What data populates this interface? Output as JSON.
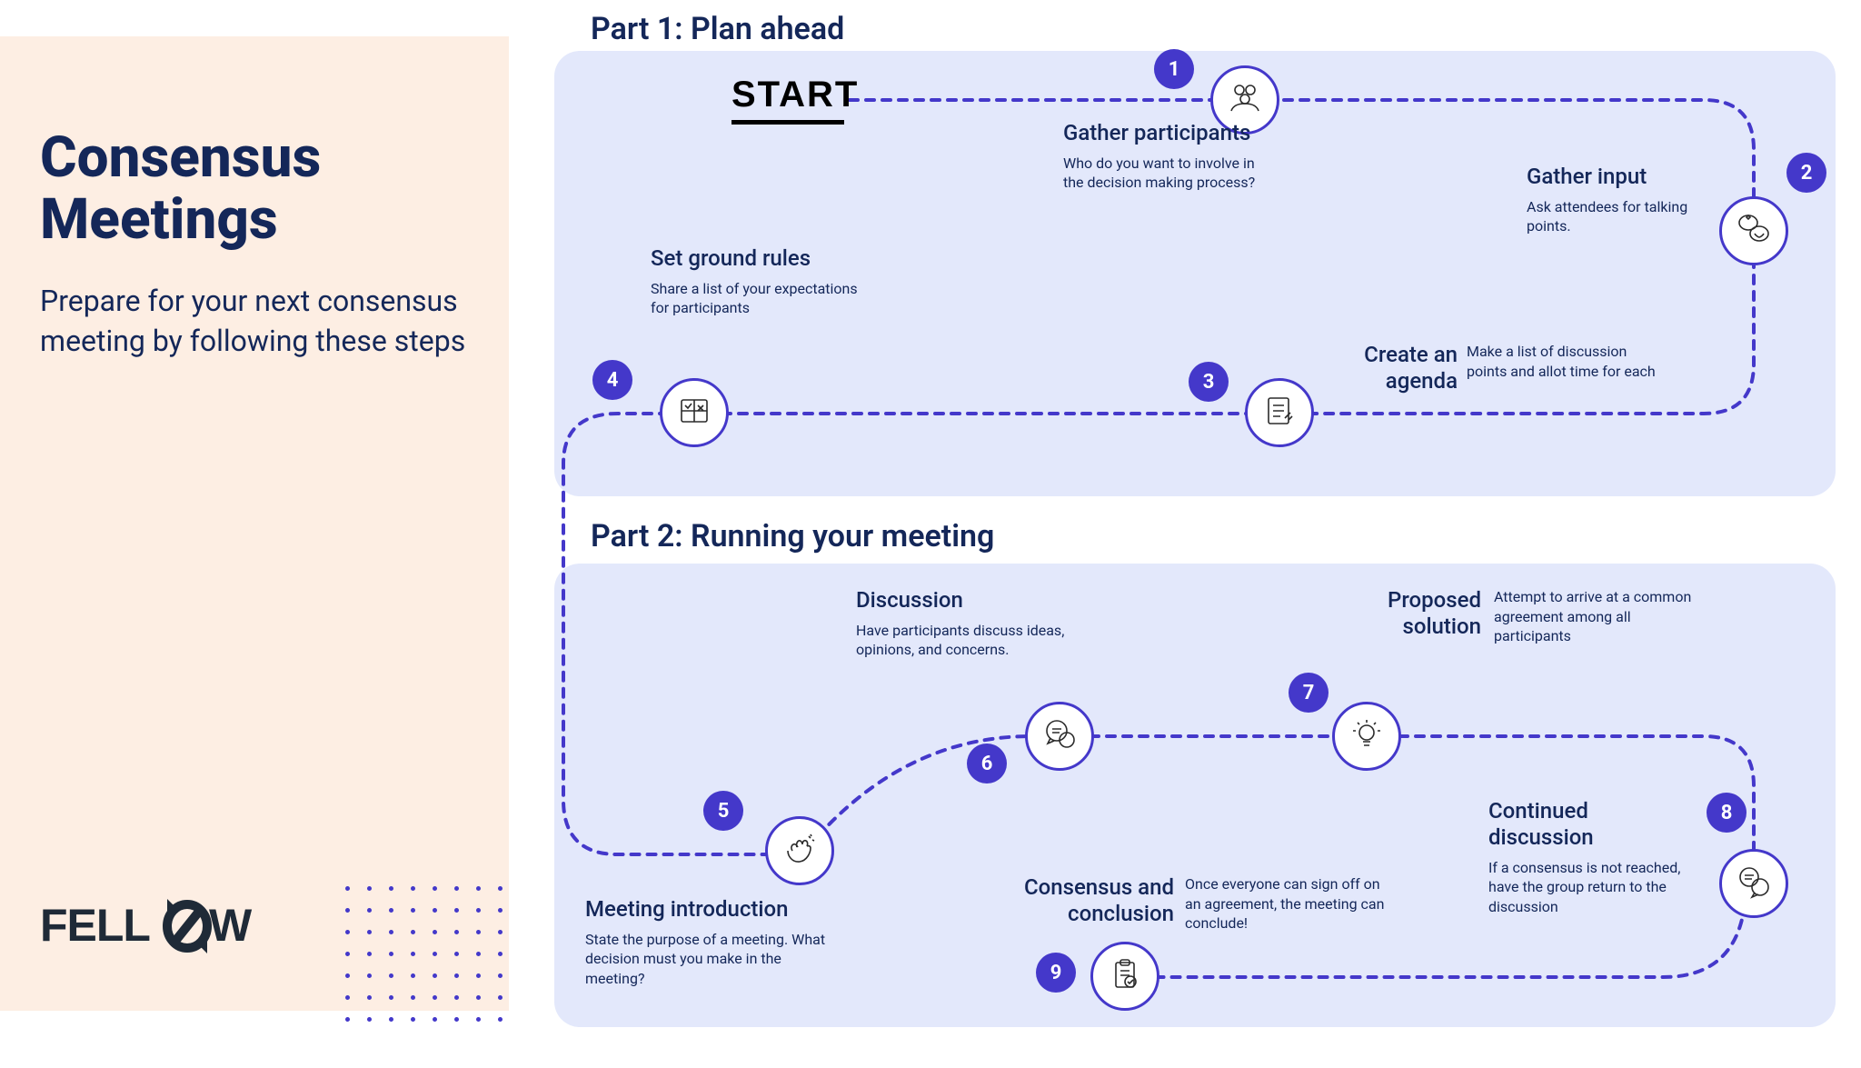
{
  "main_title": "Consensus Meetings",
  "subtitle": "Prepare for your next consensus meeting by following these steps",
  "logo_text": "FELLOW",
  "start_label": "START",
  "part1_title": "Part 1: Plan ahead",
  "part2_title": "Part 2: Running your meeting",
  "steps": {
    "s1": {
      "num": "1",
      "title": "Gather participants",
      "desc": "Who do you want to involve in the decision making process?"
    },
    "s2": {
      "num": "2",
      "title": "Gather input",
      "desc": "Ask attendees for talking points."
    },
    "s3": {
      "num": "3",
      "title": "Create an agenda",
      "desc": "Make a list of discussion points and allot time for each"
    },
    "s4": {
      "num": "4",
      "title": "Set ground rules",
      "desc": "Share a list of your expectations for participants"
    },
    "s5": {
      "num": "5",
      "title": "Meeting introduction",
      "desc": "State the purpose of a meeting. What decision must you make in the meeting?"
    },
    "s6": {
      "num": "6",
      "title": "Discussion",
      "desc": "Have participants discuss ideas, opinions, and concerns."
    },
    "s7": {
      "num": "7",
      "title": "Proposed solution",
      "desc": "Attempt to arrive at a common agreement among all participants"
    },
    "s8": {
      "num": "8",
      "title": "Continued discussion",
      "desc": "If a consensus is not reached, have the group return to the discussion"
    },
    "s9": {
      "num": "9",
      "title": "Consensus and conclusion",
      "desc": "Once everyone can sign off on an agreement, the meeting can conclude!"
    }
  }
}
